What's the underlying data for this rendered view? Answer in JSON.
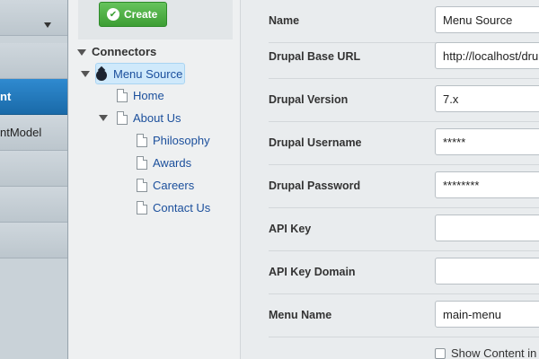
{
  "nav": {
    "items": [
      {
        "label": ""
      },
      {
        "label": ""
      },
      {
        "label": "nt"
      },
      {
        "label": "ntModel"
      },
      {
        "label": ""
      },
      {
        "label": ""
      },
      {
        "label": ""
      }
    ]
  },
  "toolbar": {
    "create_label": "Create"
  },
  "tree": {
    "root_label": "Connectors",
    "selected": "Menu Source",
    "children": [
      "Home",
      "About Us"
    ],
    "about_children": [
      "Philosophy",
      "Awards",
      "Careers",
      "Contact Us"
    ]
  },
  "form": {
    "fields": [
      {
        "label": "Name",
        "value": "Menu Source"
      },
      {
        "label": "Drupal Base URL",
        "value": "http://localhost/drupal"
      },
      {
        "label": "Drupal Version",
        "value": "7.x"
      },
      {
        "label": "Drupal Username",
        "value": "*****"
      },
      {
        "label": "Drupal Password",
        "value": "********"
      },
      {
        "label": "API Key",
        "value": ""
      },
      {
        "label": "API Key Domain",
        "value": ""
      },
      {
        "label": "Menu Name",
        "value": "main-menu"
      }
    ],
    "checkbox_label": "Show Content in M"
  },
  "colors": {
    "accent": "#1a6aa9",
    "create": "#3d9e34",
    "link": "#1b4f9c"
  }
}
